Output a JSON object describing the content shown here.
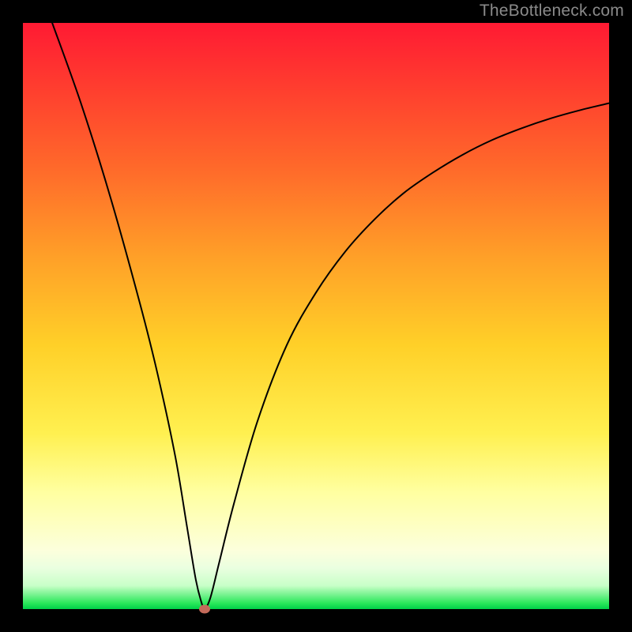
{
  "watermark": "TheBottleneck.com",
  "colors": {
    "curve": "#000000",
    "marker": "#c46a5a"
  },
  "chart_data": {
    "type": "line",
    "title": "",
    "xlabel": "",
    "ylabel": "",
    "xlim": [
      0,
      100
    ],
    "ylim": [
      0,
      100
    ],
    "grid": false,
    "legend": false,
    "marker": {
      "x": 31,
      "y": 0
    },
    "x": [
      5,
      10,
      15,
      20,
      23,
      26,
      28,
      29.5,
      30.5,
      31,
      32,
      33.5,
      36,
      40,
      45,
      50,
      55,
      60,
      65,
      70,
      75,
      80,
      85,
      90,
      95,
      100
    ],
    "values": [
      100,
      86,
      70,
      52,
      40,
      26,
      14,
      5,
      1,
      0,
      2,
      8,
      18,
      32,
      45,
      54,
      61,
      66.5,
      71,
      74.5,
      77.5,
      80,
      82,
      83.7,
      85.1,
      86.3
    ]
  }
}
